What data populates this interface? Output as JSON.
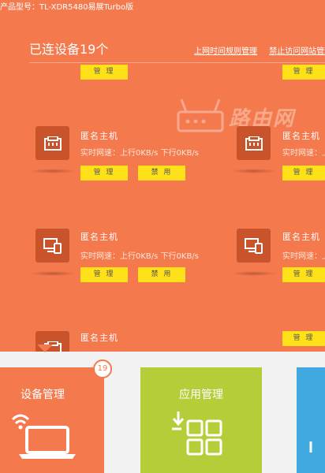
{
  "header": {
    "model": "产品型号：TL-XDR5480易展Turbo版"
  },
  "panel": {
    "title": "已连设备19个",
    "links": [
      "上网时间规则管理",
      "禁止访问网站管理"
    ]
  },
  "watermark": {
    "text": "路由网"
  },
  "devices": {
    "name": "匿名主机",
    "speed_left": "实时网速：上行0KB/s  下行0KB/s",
    "speed_right": "实时网速：上",
    "manage_label": "管 理",
    "block_label": "禁 用"
  },
  "tiles": {
    "devices_label": "设备管理",
    "apps_label": "应用管理",
    "badge_count": "19"
  },
  "colors": {
    "panel": "#f47a4e",
    "button": "#ffe11a",
    "apps_tile": "#b4cd38",
    "third_tile": "#3fa9e0"
  }
}
